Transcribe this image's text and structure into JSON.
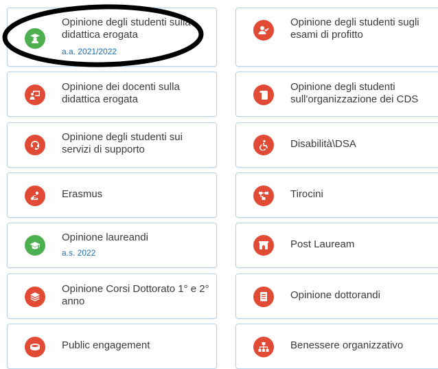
{
  "colors": {
    "red": "#e14b35",
    "green": "#4caf50",
    "title": "#3a3a3a",
    "sub": "#1e6fb5",
    "border": "#b5d3ea"
  },
  "cards": [
    {
      "title": "Opinione degli studenti sulla didattica erogata",
      "sub": "a.a. 2021/2022",
      "icon": "graduate-student-icon",
      "color": "#4caf50"
    },
    {
      "title": "Opinione degli studenti sugli esami di profitto",
      "icon": "user-check-icon",
      "color": "#e14b35"
    },
    {
      "title": "Opinione dei docenti sulla didattica erogata",
      "icon": "teacher-board-icon",
      "color": "#e14b35"
    },
    {
      "title": "Opinione degli studenti sull'organizzazione dei CDS",
      "icon": "scroll-icon",
      "color": "#e14b35"
    },
    {
      "title": "Opinione degli studenti sui servizi di supporto",
      "icon": "headset-icon",
      "color": "#e14b35"
    },
    {
      "title": "Disabilità\\DSA",
      "icon": "wheelchair-icon",
      "color": "#e14b35"
    },
    {
      "title": "Erasmus",
      "icon": "route-icon",
      "color": "#e14b35"
    },
    {
      "title": "Tirocini",
      "icon": "network-icon",
      "color": "#e14b35"
    },
    {
      "title": "Opinione laureandi",
      "sub": "a.s. 2022",
      "icon": "graduation-cap-icon",
      "color": "#4caf50"
    },
    {
      "title": "Post Lauream",
      "icon": "archway-icon",
      "color": "#e14b35"
    },
    {
      "title": "Opinione Corsi Dottorato 1° e 2° anno",
      "icon": "layers-icon",
      "color": "#e14b35"
    },
    {
      "title": "Opinione dottorandi",
      "icon": "receipt-icon",
      "color": "#e14b35"
    },
    {
      "title": "Public engagement",
      "icon": "ring-icon",
      "color": "#e14b35"
    },
    {
      "title": "Benessere organizzativo",
      "icon": "sitemap-icon",
      "color": "#e14b35"
    }
  ]
}
